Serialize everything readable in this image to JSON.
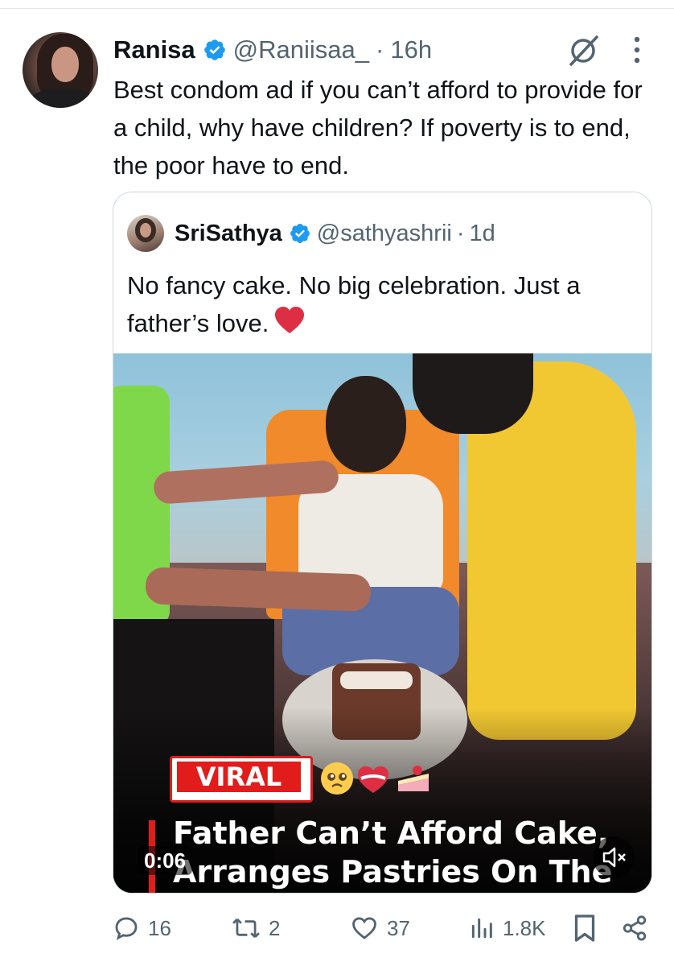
{
  "tweet": {
    "author_name": "Ranisa",
    "author_handle": "@Raniisaa_",
    "separator": "·",
    "time": "16h",
    "text": "Best condom ad if you can’t afford to provide for a child, why have children? If poverty is to end, the poor have to end."
  },
  "quote": {
    "author_name": "SriSathya",
    "author_handle": "@sathyashrii",
    "separator": "·",
    "time": "1d",
    "text": "No fancy cake. No big celebration. Just a father’s love.",
    "media": {
      "badge": "VIRAL",
      "emojis": "🥺❤️🍰",
      "headline": "Father Can’t Afford Cake, Arranges Pastries On The",
      "timer": "0:06"
    }
  },
  "actions": {
    "replies": "16",
    "reposts": "2",
    "likes": "37",
    "views": "1.8K"
  },
  "colors": {
    "verified": "#1d9bf0",
    "secondary_text": "#536471",
    "viral_red": "#e21b1b"
  },
  "icons": [
    "grok-icon",
    "more-icon",
    "verified-badge-icon",
    "heart-emoji",
    "mute-icon",
    "reply-icon",
    "repost-icon",
    "like-icon",
    "views-icon",
    "bookmark-icon",
    "share-icon"
  ]
}
